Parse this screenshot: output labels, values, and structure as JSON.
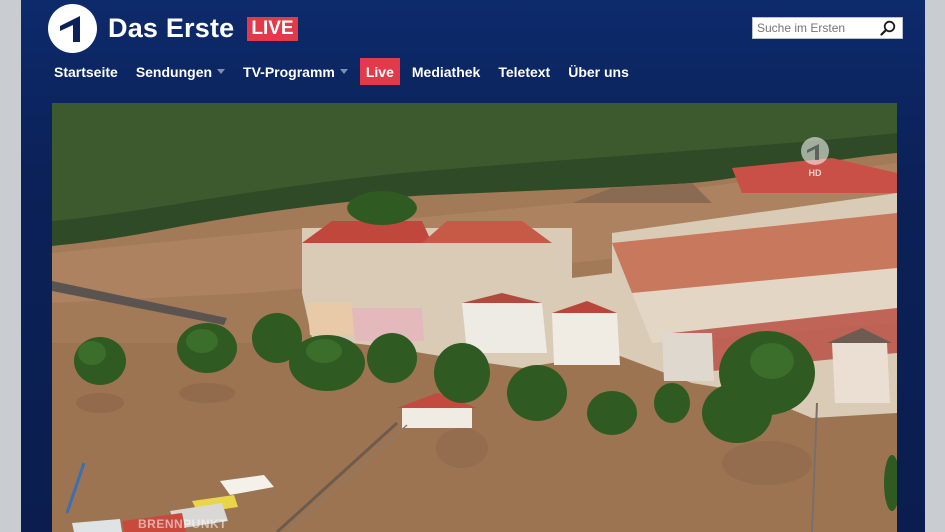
{
  "header": {
    "brand": "Das Erste",
    "live_badge": "LIVE",
    "search": {
      "placeholder": "Suche im Ersten"
    }
  },
  "nav": {
    "items": [
      {
        "label": "Startseite"
      },
      {
        "label": "Sendungen"
      },
      {
        "label": "TV-Programm"
      },
      {
        "label": "Live"
      },
      {
        "label": "Mediathek"
      },
      {
        "label": "Teletext"
      },
      {
        "label": "Über uns"
      }
    ]
  },
  "player": {
    "hd_label": "HD",
    "watermark": "BRENNPUNKT"
  },
  "colors": {
    "header_bg": "#0b2157",
    "accent": "#e23a4b"
  }
}
